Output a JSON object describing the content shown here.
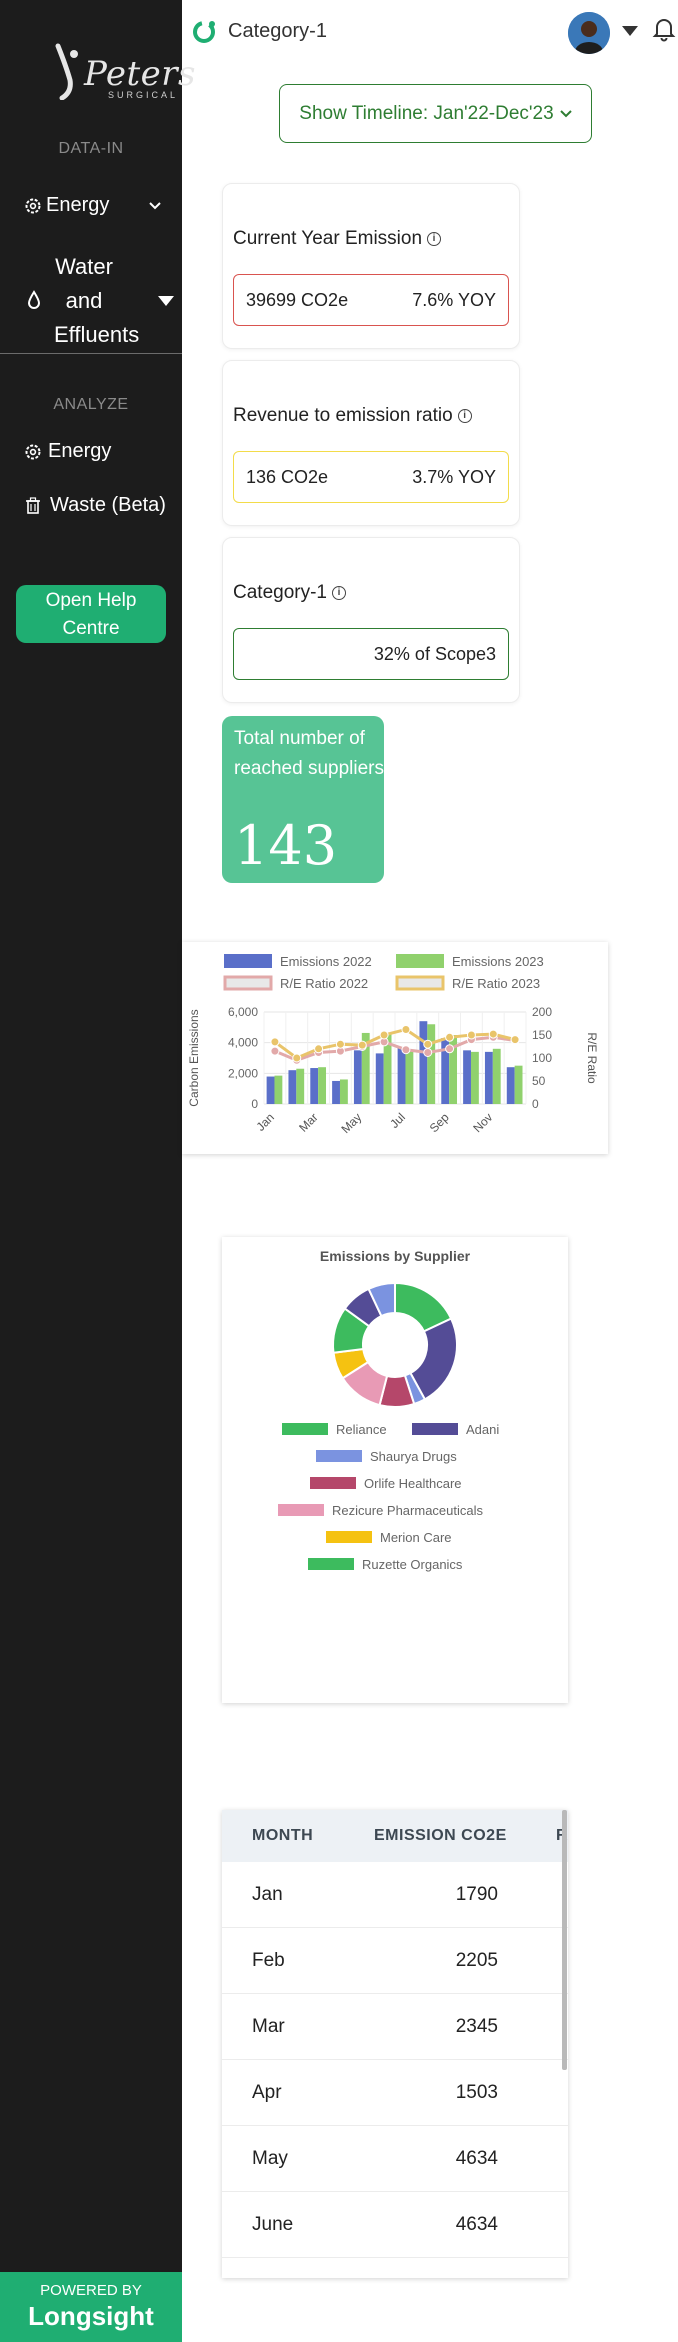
{
  "brand": {
    "logo_text": "Peters",
    "logo_sub": "SURGICAL"
  },
  "sidebar": {
    "data_in_label": "DATA-IN",
    "energy_label": "Energy",
    "water_label": "Water and Effluents",
    "analyze_label": "ANALYZE",
    "analyze_energy_label": "Energy",
    "waste_label": "Waste (Beta)",
    "help_label": "Open Help Centre",
    "powered_by": "POWERED BY",
    "powered_brand": "Longsight"
  },
  "header": {
    "title": "Category-1"
  },
  "timeline": {
    "label": "Show Timeline: Jan'22-Dec'23"
  },
  "cards": [
    {
      "title": "Current Year Emission",
      "value": "39699 CO2e",
      "change": "7.6% YOY",
      "border": "#d9534f"
    },
    {
      "title": "Revenue to emission ratio",
      "value": "136 CO2e",
      "change": "3.7% YOY",
      "border": "#f3dc4a"
    },
    {
      "title": "Category-1",
      "value": "",
      "change": "32% of Scope3",
      "border": "#2e7d32"
    }
  ],
  "total_suppliers": {
    "label": "Total number of reached suppliers",
    "value": "143"
  },
  "chart_data": [
    {
      "type": "bar",
      "title": "",
      "categories": [
        "Jan",
        "Feb",
        "Mar",
        "Apr",
        "May",
        "Jun",
        "Jul",
        "Aug",
        "Sep",
        "Oct",
        "Nov",
        "Dec"
      ],
      "tick_labels": [
        "Jan",
        "Mar",
        "May",
        "Jul",
        "Sep",
        "Nov"
      ],
      "series": [
        {
          "name": "Emissions 2022",
          "kind": "bar",
          "axis": "left",
          "color": "#5a6fc9",
          "values": [
            1790,
            2205,
            2345,
            1503,
            3500,
            3300,
            3700,
            5400,
            4300,
            3500,
            3400,
            2400
          ]
        },
        {
          "name": "Emissions 2023",
          "kind": "bar",
          "axis": "left",
          "color": "#90d16d",
          "values": [
            1850,
            2300,
            2400,
            1600,
            4634,
            4634,
            3500,
            5200,
            4500,
            3400,
            3600,
            2500
          ]
        },
        {
          "name": "R/E Ratio 2022",
          "kind": "line",
          "axis": "right",
          "color": "#e2a9a9",
          "values": [
            115,
            95,
            112,
            115,
            125,
            135,
            118,
            112,
            120,
            140,
            145,
            138
          ]
        },
        {
          "name": "R/E Ratio 2023",
          "kind": "line",
          "axis": "right",
          "color": "#e9c46a",
          "values": [
            135,
            100,
            120,
            130,
            128,
            150,
            162,
            130,
            145,
            150,
            152,
            140
          ]
        }
      ],
      "xlabel": "",
      "ylabel": "Carbon Emissions",
      "y2label": "R/E Ratio",
      "ylim": [
        0,
        6000
      ],
      "y_ticks": [
        0,
        2000,
        4000,
        6000
      ],
      "y_tick_labels": [
        "0",
        "2,000",
        "4,000",
        "6,000"
      ],
      "y2lim": [
        0,
        200
      ],
      "y2_ticks": [
        0,
        50,
        100,
        150,
        200
      ],
      "legend": "top",
      "grid": true
    },
    {
      "type": "pie",
      "title": "Emissions by Supplier",
      "donut": true,
      "slices": [
        {
          "name": "Reliance",
          "value": 18,
          "color": "#3dbb5e"
        },
        {
          "name": "Adani",
          "value": 24,
          "color": "#544c96"
        },
        {
          "name": "Shaurya Drugs",
          "value": 3,
          "color": "#7b93e0"
        },
        {
          "name": "Orlife Healthcare",
          "value": 9,
          "color": "#b5476a"
        },
        {
          "name": "Rezicure Pharmaceuticals",
          "value": 12,
          "color": "#e89ab5"
        },
        {
          "name": "Merion Care",
          "value": 7,
          "color": "#f5c211"
        },
        {
          "name": "Ruzette Organics",
          "value": 12,
          "color": "#3dbb5e"
        },
        {
          "name": "",
          "value": 8,
          "color": "#544c96"
        },
        {
          "name": "",
          "value": 7,
          "color": "#7b93e0"
        }
      ],
      "legend": "bottom"
    }
  ],
  "table": {
    "headers": [
      "MONTH",
      "EMISSION CO2E",
      "R"
    ],
    "rows": [
      {
        "month": "Jan",
        "value": "1790"
      },
      {
        "month": "Feb",
        "value": "2205"
      },
      {
        "month": "Mar",
        "value": "2345"
      },
      {
        "month": "Apr",
        "value": "1503"
      },
      {
        "month": "May",
        "value": "4634"
      },
      {
        "month": "June",
        "value": "4634"
      }
    ]
  },
  "colors": {
    "sidebar": "#1c1c1c",
    "accent": "#1fae72",
    "suppliers_card": "#57c495"
  },
  "icons": [
    "energy-gear-icon",
    "water-drop-icon",
    "trash-icon",
    "bell-icon",
    "category-icon",
    "chevron-down-icon"
  ]
}
